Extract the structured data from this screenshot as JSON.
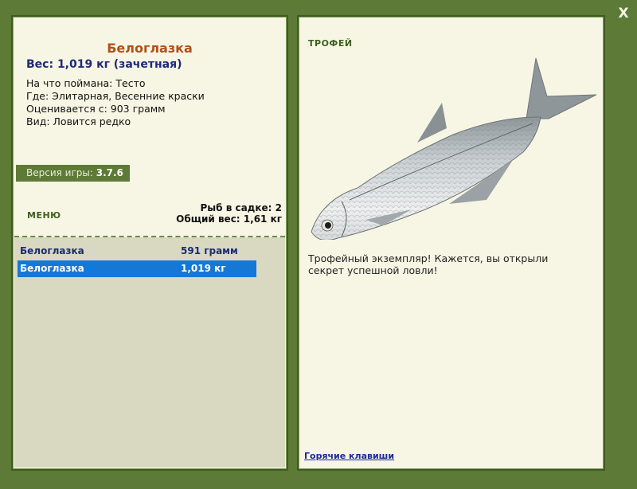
{
  "window": {
    "close_label": "X"
  },
  "fish": {
    "name": "Белоглазка",
    "weight": "Вес: 1,019 кг (зачетная)",
    "details": [
      "На что поймана: Тесто",
      "Где: Элитарная, Весенние краски",
      "Оценивается с: 903 грамм",
      "Вид: Ловится редко"
    ]
  },
  "version": {
    "label": "Версия игры:",
    "value": "3.7.6"
  },
  "menu": {
    "label": "МЕНЮ"
  },
  "stats": {
    "count": "Рыб в садке: 2",
    "total": "Общий вес: 1,61 кг"
  },
  "catch_list": [
    {
      "name": "Белоглазка",
      "weight": "591 грамм"
    },
    {
      "name": "Белоглазка",
      "weight": "1,019 кг"
    }
  ],
  "trophy": {
    "title": "ТРОФЕЙ",
    "text": "Трофейный экземпляр! Кажется, вы открыли секрет успешной ловли!",
    "hotkeys": "Горячие клавиши"
  },
  "colors": {
    "frame": "#5d7a36",
    "panel": "#f7f6e4",
    "selected": "#1578d6",
    "fish_name": "#b0501b"
  }
}
